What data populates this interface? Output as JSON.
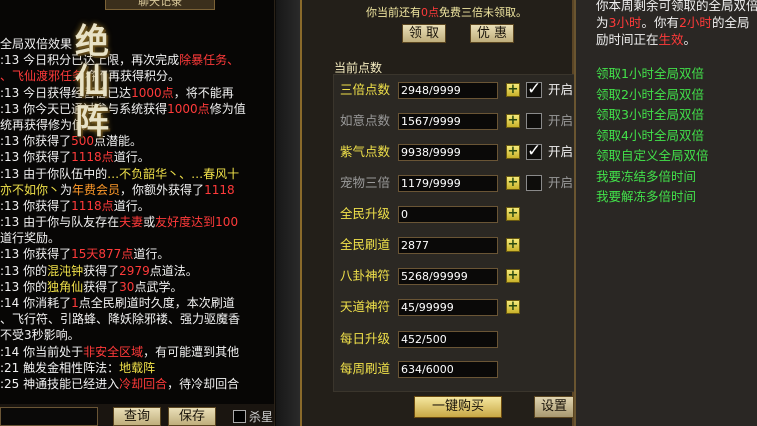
{
  "chat": {
    "tab_title": "聊天记录",
    "logo_chars": [
      "绝",
      "仙",
      "阵"
    ],
    "lines": [
      [
        {
          "t": "全局双倍效果",
          "c": ""
        }
      ],
      [
        {
          "t": ":13 今日积分已达上限，再次完成",
          "c": ""
        },
        {
          "t": "除暴任务、",
          "c": "r"
        }
      ],
      [
        {
          "t": "、飞仙渡邪任务",
          "c": "r"
        },
        {
          "t": "将不再获得积分。",
          "c": ""
        }
      ],
      [
        {
          "t": ":13 今日获得经营值已达",
          "c": ""
        },
        {
          "t": "1000点",
          "c": "r"
        },
        {
          "t": "，将不能再",
          "c": ""
        }
      ],
      [
        {
          "t": ":13 你今天已通过参与系统获得",
          "c": ""
        },
        {
          "t": "1000点",
          "c": "r"
        },
        {
          "t": "修为值",
          "c": ""
        }
      ],
      [
        {
          "t": "统再获得修为值。",
          "c": ""
        }
      ],
      [
        {
          "t": ":13 你获得了",
          "c": ""
        },
        {
          "t": "500",
          "c": "r"
        },
        {
          "t": "点潜能。",
          "c": ""
        }
      ],
      [
        {
          "t": ":13 你获得了",
          "c": ""
        },
        {
          "t": "1118点",
          "c": "r"
        },
        {
          "t": "道行。",
          "c": ""
        }
      ],
      [
        {
          "t": ":13 由于你队伍中的",
          "c": ""
        },
        {
          "t": "…不负韶华丶、…春风十",
          "c": "y"
        }
      ],
      [
        {
          "t": "亦不如你丶",
          "c": "y"
        },
        {
          "t": "为",
          "c": ""
        },
        {
          "t": "年费会员",
          "c": "o"
        },
        {
          "t": "，你额外获得了",
          "c": ""
        },
        {
          "t": "1118",
          "c": "r"
        }
      ],
      [
        {
          "t": ":13 你获得了",
          "c": ""
        },
        {
          "t": "1118点",
          "c": "r"
        },
        {
          "t": "道行。",
          "c": ""
        }
      ],
      [
        {
          "t": ":13 由于你与队友存在",
          "c": ""
        },
        {
          "t": "夫妻",
          "c": "r"
        },
        {
          "t": "或",
          "c": ""
        },
        {
          "t": "友好度达到100",
          "c": "r"
        }
      ],
      [
        {
          "t": "道行奖励。",
          "c": ""
        }
      ],
      [
        {
          "t": ":13 你获得了",
          "c": ""
        },
        {
          "t": "15天877点",
          "c": "r"
        },
        {
          "t": "道行。",
          "c": ""
        }
      ],
      [
        {
          "t": ":13 你的",
          "c": ""
        },
        {
          "t": "混沌钟",
          "c": "y"
        },
        {
          "t": "获得了",
          "c": ""
        },
        {
          "t": "2979",
          "c": "r"
        },
        {
          "t": "点道法。",
          "c": ""
        }
      ],
      [
        {
          "t": ":13 你的",
          "c": ""
        },
        {
          "t": "独角仙",
          "c": "y"
        },
        {
          "t": "获得了",
          "c": ""
        },
        {
          "t": "30",
          "c": "r"
        },
        {
          "t": "点武学。",
          "c": ""
        }
      ],
      [
        {
          "t": ":14 你消耗了",
          "c": ""
        },
        {
          "t": "1",
          "c": "r"
        },
        {
          "t": "点全民刷道时久度，本次刷道",
          "c": ""
        }
      ],
      [
        {
          "t": "、飞行符、引路蜂、降妖除邪褛、强力驱魔香",
          "c": ""
        }
      ],
      [
        {
          "t": "不受3秒影响。",
          "c": ""
        }
      ],
      [
        {
          "t": ":14 你当前处于",
          "c": ""
        },
        {
          "t": "非安全区域",
          "c": "r"
        },
        {
          "t": "，有可能遭到其他",
          "c": ""
        }
      ],
      [
        {
          "t": ":21 触发金相性阵法：",
          "c": ""
        },
        {
          "t": "地载阵",
          "c": "y"
        }
      ],
      [
        {
          "t": ":25 神通技能已经进入",
          "c": ""
        },
        {
          "t": "冷却回合",
          "c": "r"
        },
        {
          "t": "，待冷却回合",
          "c": ""
        }
      ]
    ],
    "query_label": "查询",
    "save_label": "保存",
    "kill_label": "杀星"
  },
  "panel": {
    "notice_prefix": "你当前还有",
    "notice_count": "0点",
    "notice_suffix": "免费三倍未领取。",
    "claim_label": "领 取",
    "offer_label": "优 惠",
    "section_title": "当前点数",
    "rows": [
      {
        "label": "三倍点数",
        "value": "2948/9999",
        "plus": true,
        "checkbox": true,
        "checked": true,
        "cb_label": "开启",
        "color": "yellow"
      },
      {
        "label": "如意点数",
        "value": "1567/9999",
        "plus": true,
        "checkbox": true,
        "checked": false,
        "cb_label": "开启",
        "color": "grey"
      },
      {
        "label": "紫气点数",
        "value": "9938/9999",
        "plus": true,
        "checkbox": true,
        "checked": true,
        "cb_label": "开启",
        "color": "yellow"
      },
      {
        "label": "宠物三倍",
        "value": "1179/9999",
        "plus": true,
        "checkbox": true,
        "checked": false,
        "cb_label": "开启",
        "color": "grey"
      },
      {
        "label": "全民升级",
        "value": "0",
        "plus": true,
        "checkbox": false,
        "color": "yellow"
      },
      {
        "label": "全民刷道",
        "value": "2877",
        "plus": true,
        "checkbox": false,
        "color": "yellow"
      },
      {
        "label": "八卦神符",
        "value": "5268/99999",
        "plus": true,
        "checkbox": false,
        "color": "yellow"
      },
      {
        "label": "天道神符",
        "value": "45/99999",
        "plus": true,
        "checkbox": false,
        "color": "yellow"
      },
      {
        "label": "每日升级",
        "value": "452/500",
        "plus": false,
        "checkbox": false,
        "color": "yellow"
      },
      {
        "label": "每周刷道",
        "value": "634/6000",
        "plus": false,
        "checkbox": false,
        "color": "yellow"
      }
    ],
    "buy_label": "一键购买",
    "setting_label": "设置"
  },
  "info": {
    "desc_1": "你本周剩余可领取的全局双倍",
    "desc_2a": "为",
    "desc_2b": "3小时",
    "desc_2c": "。你有",
    "desc_2d": "2小时",
    "desc_2e": "的全局",
    "desc_3a": "励时间正在",
    "desc_3b": "生效",
    "desc_3c": "。",
    "links": [
      "领取1小时全局双倍",
      "领取2小时全局双倍",
      "领取3小时全局双倍",
      "领取4小时全局双倍",
      "领取自定义全局双倍",
      "我要冻结多倍时间",
      "我要解冻多倍时间"
    ]
  }
}
